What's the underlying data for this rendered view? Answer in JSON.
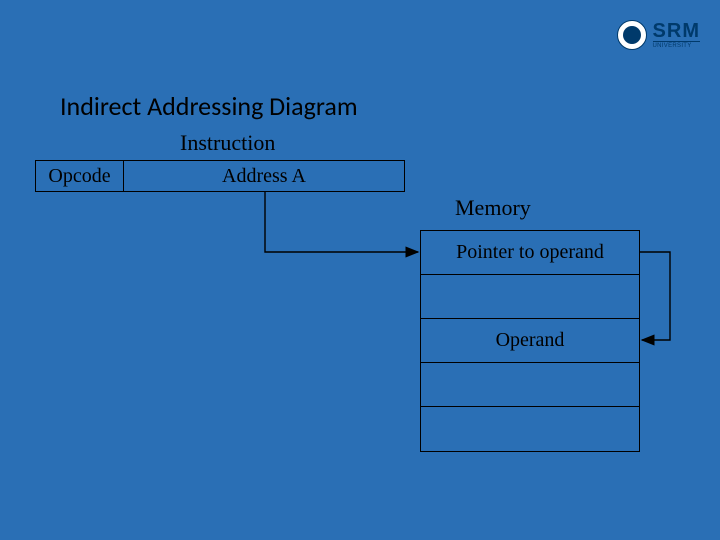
{
  "logo": {
    "brand": "SRM",
    "subtitle": "UNIVERSITY"
  },
  "title": "Indirect Addressing Diagram",
  "instruction_label": "Instruction",
  "instruction": {
    "opcode_label": "Opcode",
    "address_label": "Address A"
  },
  "memory": {
    "label": "Memory",
    "rows": [
      "Pointer to operand",
      "",
      "Operand",
      "",
      ""
    ]
  }
}
